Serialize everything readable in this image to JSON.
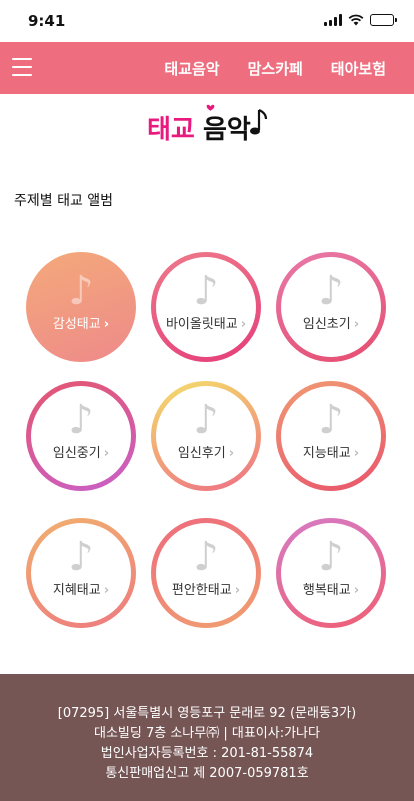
{
  "status": {
    "time": "9:41"
  },
  "nav": {
    "items": [
      {
        "label": "태교음악"
      },
      {
        "label": "맘스카페"
      },
      {
        "label": "태아보험"
      }
    ]
  },
  "logo": {
    "text": "태교음악",
    "colors": [
      "#e8197f",
      "#111111"
    ]
  },
  "section": {
    "title": "주제별 태교 앨범"
  },
  "albums": [
    {
      "label": "감성태교",
      "style": "filled",
      "colors": [
        "#f4a97a",
        "#ee8a8a"
      ]
    },
    {
      "label": "바이올릿태교",
      "colors": [
        "#ee7a8a",
        "#e43d7a"
      ]
    },
    {
      "label": "임신초기",
      "colors": [
        "#e77aa9",
        "#e64d6f"
      ]
    },
    {
      "label": "임신중기",
      "colors": [
        "#e5566f",
        "#c85fc9"
      ]
    },
    {
      "label": "임신후기",
      "colors": [
        "#f4e06a",
        "#ee6e85"
      ]
    },
    {
      "label": "지능태교",
      "colors": [
        "#f09a74",
        "#e8546b"
      ]
    },
    {
      "label": "지혜태교",
      "colors": [
        "#f1b06e",
        "#ee7a7f"
      ]
    },
    {
      "label": "편안한태교",
      "colors": [
        "#ee6a7d",
        "#f0a070"
      ]
    },
    {
      "label": "행복태교",
      "colors": [
        "#d67bc6",
        "#ef5f73"
      ]
    }
  ],
  "footer": {
    "line1": "[07295] 서울특별시 영등포구 문래로 92 (문래동3가)",
    "line2": "대소빌딩 7층 소나무㈜  | 대표이사:가나다",
    "line3": "법인사업자등록번호 : 201-81-55874",
    "line4": "통신판매업신고 제 2007-059781호"
  },
  "theme": {
    "primary": "#ee6e7f",
    "footer_bg": "#765655"
  }
}
